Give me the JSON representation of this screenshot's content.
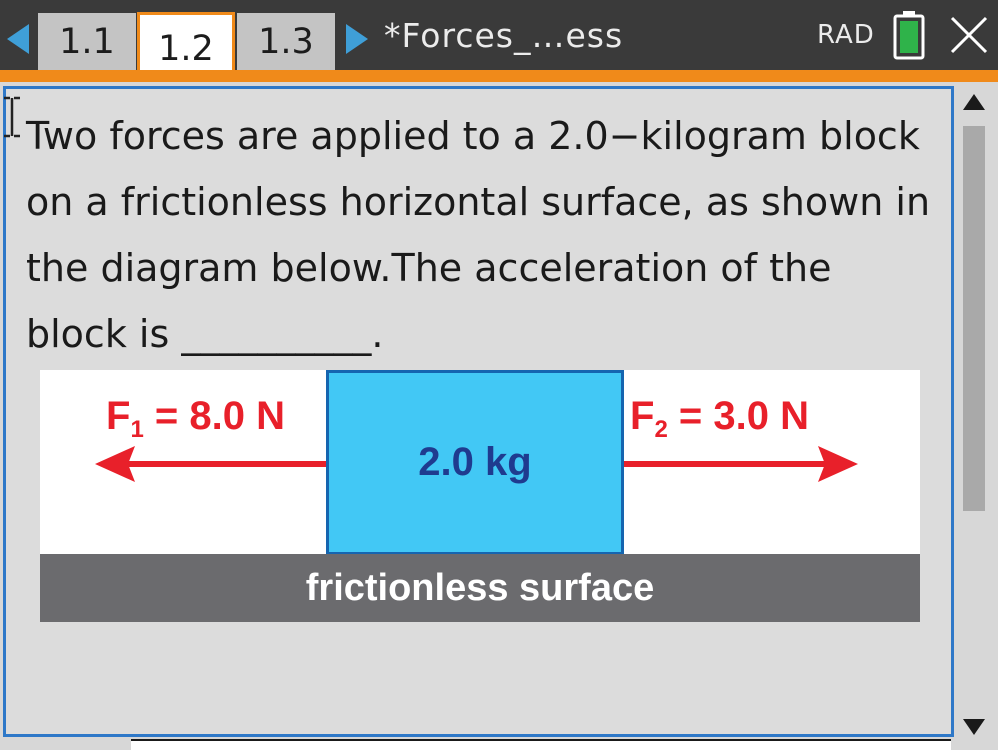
{
  "tabs": [
    {
      "label": "1.1",
      "active": false
    },
    {
      "label": "1.2",
      "active": true
    },
    {
      "label": "1.3",
      "active": false
    }
  ],
  "document_title": "*Forces_…ess",
  "status": {
    "angle_mode": "RAD",
    "battery_color": "#2fb34a"
  },
  "icons": [
    "previous-page-icon",
    "next-page-icon",
    "battery-icon",
    "close-icon",
    "text-cursor-icon",
    "scroll-up-icon",
    "scroll-down-icon"
  ],
  "question": {
    "text": "Two forces are applied to a 2.0−kilogram block on a frictionless horizontal surface, as shown in the diagram below.The acceleration of the block is __________."
  },
  "diagram": {
    "block_label": "2.0 kg",
    "force1": {
      "symbol": "F",
      "subscript": "1",
      "value": "= 8.0 N",
      "direction": "left"
    },
    "force2": {
      "symbol": "F",
      "subscript": "2",
      "value": "= 3.0 N",
      "direction": "right"
    },
    "surface_label": "frictionless surface",
    "colors": {
      "force": "#e8202a",
      "block": "#42c8f5",
      "block_border": "#1565b0",
      "surface": "#6b6b6e"
    }
  }
}
